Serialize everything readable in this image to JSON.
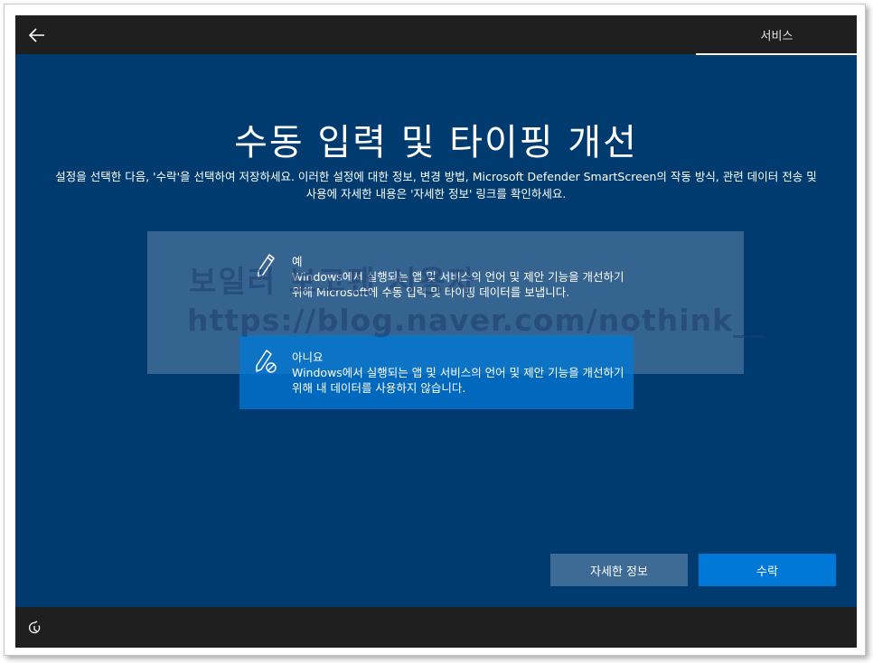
{
  "topbar": {
    "back_icon": "back-arrow-icon",
    "tab_label": "서비스"
  },
  "main": {
    "title": "수동 입력 및 타이핑 개선",
    "description": "설정을 선택한 다음, '수락'을 선택하여 저장하세요. 이러한 설정에 대한 정보, 변경 방법, Microsoft Defender SmartScreen의 작동 방식, 관련 데이터 전송 및 사용에 자세한 내용은 '자세한 정보' 링크를 확인하세요."
  },
  "watermark": {
    "line1": "보일러 보고팬 시용자",
    "line2": "https://blog.naver.com/nothink__"
  },
  "options": [
    {
      "icon": "pen-icon",
      "label": "예",
      "description": "Windows에서 실행되는 앱 및 서비스의 언어 및 제안 기능을 개선하기 위해 Microsoft에 수동 입력 및 타이핑 데이터를 보냅니다.",
      "selected": false
    },
    {
      "icon": "pen-off-icon",
      "label": "아니요",
      "description": "Windows에서 실행되는 앱 및 서비스의 언어 및 제안 기능을 개선하기 위해 내 데이터를 사용하지 않습니다.",
      "selected": true
    }
  ],
  "buttons": {
    "more_info": "자세한 정보",
    "accept": "수락"
  },
  "bottombar": {
    "ease_icon": "ease-of-access-icon"
  },
  "colors": {
    "background": "#003b6f",
    "bar": "#1f1f1f",
    "accent": "#0078d7",
    "secondary_button": "#3e6a96"
  }
}
